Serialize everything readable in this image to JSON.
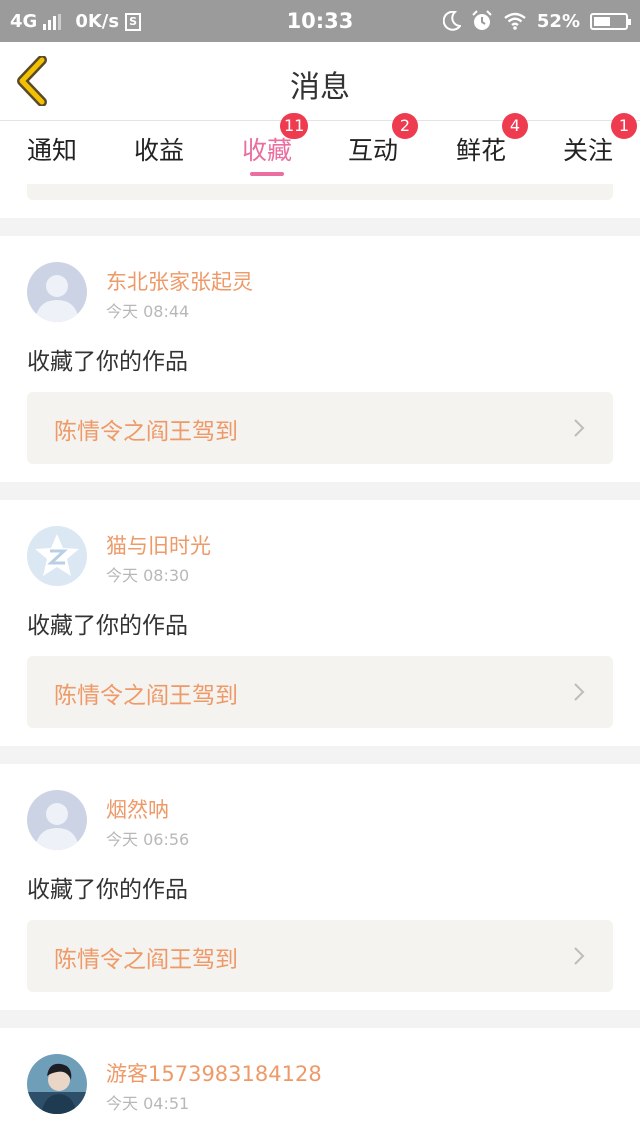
{
  "status_bar": {
    "network": "4G",
    "speed": "0K/s",
    "s_icon_label": "S",
    "time": "10:33",
    "battery": "52%",
    "battery_level": 0.52
  },
  "header": {
    "title": "消息"
  },
  "tabs": [
    {
      "label": "通知",
      "badge": "",
      "active": false
    },
    {
      "label": "收益",
      "badge": "",
      "active": false
    },
    {
      "label": "收藏",
      "badge": "11",
      "active": true
    },
    {
      "label": "互动",
      "badge": "2",
      "active": false
    },
    {
      "label": "鲜花",
      "badge": "4",
      "active": false
    },
    {
      "label": "关注",
      "badge": "1",
      "active": false
    }
  ],
  "messages": [
    {
      "username": "东北张家张起灵",
      "time": "今天 08:44",
      "action": "收藏了你的作品",
      "work": "陈情令之阎王驾到",
      "avatar": "default-avatar-icon"
    },
    {
      "username": "猫与旧时光",
      "time": "今天 08:30",
      "action": "收藏了你的作品",
      "work": "陈情令之阎王驾到",
      "avatar": "qq-avatar-icon"
    },
    {
      "username": "烟然呐",
      "time": "今天 06:56",
      "action": "收藏了你的作品",
      "work": "陈情令之阎王驾到",
      "avatar": "default-avatar-icon"
    },
    {
      "username": "游客1573983184128",
      "time": "今天 04:51",
      "action": "",
      "work": "",
      "avatar": "photo-avatar"
    }
  ],
  "colors": {
    "accent": "#ea6e9f",
    "username": "#ee9a68",
    "badge": "#ef3b4f",
    "back_arrow": "#f2c200"
  }
}
